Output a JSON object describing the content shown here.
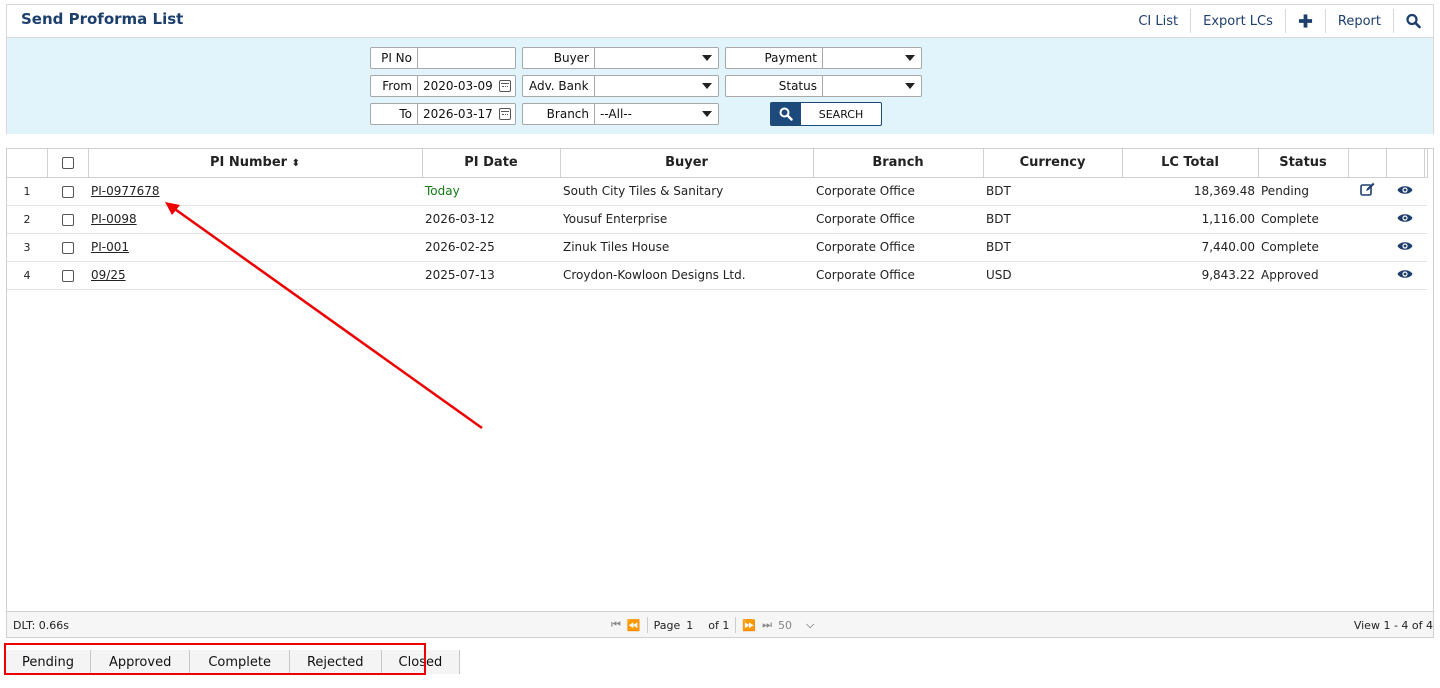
{
  "header": {
    "title": "Send Proforma List",
    "toolbar": {
      "ci_list": "CI List",
      "export_lcs": "Export LCs",
      "report": "Report"
    }
  },
  "filters": {
    "pi_no": {
      "label": "PI No",
      "value": ""
    },
    "from": {
      "label": "From",
      "value": "2020-03-09"
    },
    "to": {
      "label": "To",
      "value": "2026-03-17"
    },
    "buyer": {
      "label": "Buyer",
      "value": ""
    },
    "adv_bank": {
      "label": "Adv. Bank",
      "value": ""
    },
    "branch": {
      "label": "Branch",
      "value": "--All--"
    },
    "payment": {
      "label": "Payment",
      "value": ""
    },
    "status": {
      "label": "Status",
      "value": ""
    },
    "search_label": "SEARCH"
  },
  "table": {
    "columns": {
      "pi_number": "PI Number",
      "pi_date": "PI Date",
      "buyer": "Buyer",
      "branch": "Branch",
      "currency": "Currency",
      "lc_total": "LC Total",
      "status": "Status"
    },
    "rows": [
      {
        "n": "1",
        "pi": "PI-0977678",
        "date": "Today",
        "buyer": "South City Tiles & Sanitary",
        "branch": "Corporate Office",
        "currency": "BDT",
        "total": "18,369.48",
        "status": "Pending"
      },
      {
        "n": "2",
        "pi": "PI-0098",
        "date": "2026-03-12",
        "buyer": "Yousuf Enterprise",
        "branch": "Corporate Office",
        "currency": "BDT",
        "total": "1,116.00",
        "status": "Complete"
      },
      {
        "n": "3",
        "pi": "PI-001",
        "date": "2026-02-25",
        "buyer": "Zinuk Tiles House",
        "branch": "Corporate Office",
        "currency": "BDT",
        "total": "7,440.00",
        "status": "Complete"
      },
      {
        "n": "4",
        "pi": "09/25",
        "date": "2025-07-13",
        "buyer": "Croydon-Kowloon Designs Ltd.",
        "branch": "Corporate Office",
        "currency": "USD",
        "total": "9,843.22",
        "status": "Approved"
      }
    ]
  },
  "footer": {
    "dlt": "DLT: 0.66s",
    "page_label": "Page",
    "page": "1",
    "of": "of 1",
    "page_size": "50",
    "view": "View 1 - 4 of 4"
  },
  "tabs": [
    "Pending",
    "Approved",
    "Complete",
    "Rejected",
    "Closed"
  ],
  "colors": {
    "brand": "#1d3f6e",
    "panel": "#e1f3fb",
    "annotation": "#e00000",
    "today": "#137a13"
  },
  "icons": {
    "add": "plus-icon",
    "search": "magnifier-icon",
    "edit": "edit-icon",
    "view": "eye-icon",
    "calendar": "calendar-icon"
  }
}
